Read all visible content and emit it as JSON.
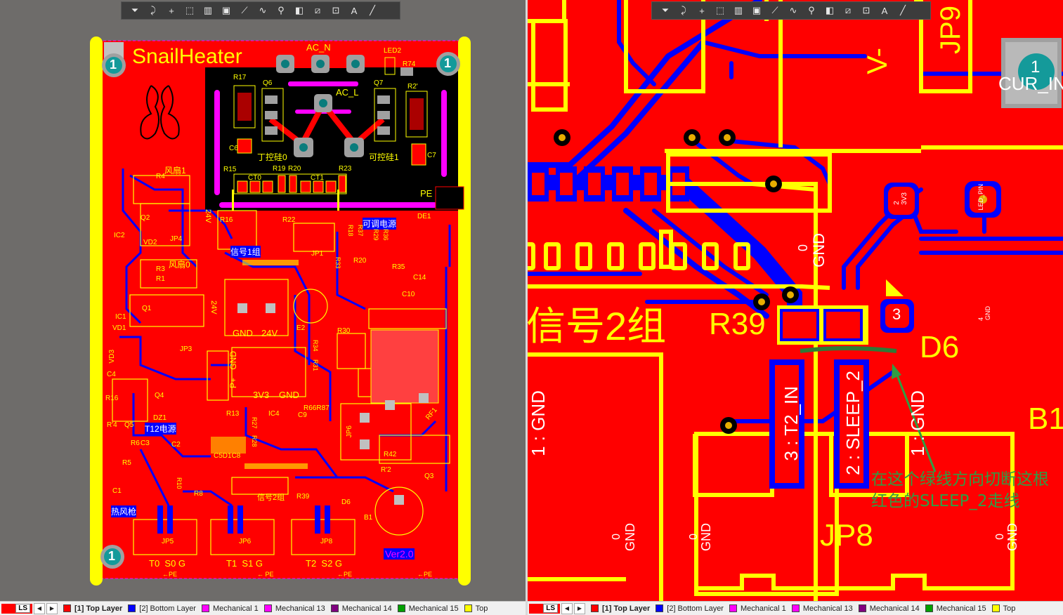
{
  "left": {
    "board": {
      "title": "SnailHeater",
      "version": "Ver2.0",
      "mount_hole_label": "1",
      "labels": {
        "ac_n": "AC_N",
        "ac_l": "AC_L",
        "led2": "LED2",
        "r74": "R74",
        "r17": "R17",
        "q6": "Q6",
        "q7": "Q7",
        "r27": "R2'",
        "c6": "C6",
        "c7": "C7",
        "iron_ctrl0": "丁控硅0",
        "iron_ctrl1": "可控硅1",
        "r15": "R15",
        "r19": "R19",
        "r20": "R20",
        "r23": "R23",
        "ct0": "CT0",
        "ct1": "CT1",
        "pe": "PE",
        "de1": "DE1",
        "fan1": "风扇1",
        "fan0": "风扇0",
        "r4": "R4",
        "r3": "R3",
        "r1": "R1",
        "q2": "Q2",
        "q1": "Q1",
        "ic2": "IC2",
        "ic1": "IC1",
        "vd1": "VD1",
        "vd2": "VD2",
        "vd3": "VD3",
        "jp4": "JP4",
        "jp3": "JP3",
        "v24": "24V",
        "v24b": "24V",
        "r16": "R16",
        "r22": "R22",
        "signal_group1": "信号1组",
        "adj_power": "可调电源",
        "jp1": "JP1",
        "r18": "R18",
        "r37": "R37",
        "r29": "R29",
        "r36": "R36",
        "r33": "R33",
        "r20b": "R20",
        "r35": "R35",
        "c14": "C14",
        "c10": "C10",
        "gnd": "GND",
        "v24c": "24V",
        "e2": "E2",
        "r30": "R30",
        "r34": "R34",
        "r31": "R31",
        "p_plus": "P+",
        "gnd_b": "GND",
        "v3v3": "3V3",
        "gnd_c": "GND",
        "c4": "C4",
        "r16b": "R16",
        "q4": "Q4",
        "dz1": "DZ1",
        "r14": "R'4",
        "q5": "Q5",
        "t12_power": "T12电源",
        "r13": "R13",
        "r27b": "R27",
        "r28": "R28",
        "ic4": "IC4",
        "c9": "C9",
        "r66r87": "R66R87",
        "rf1": "RF1",
        "r6": "R6",
        "c3": "C3",
        "c2": "C2",
        "r5": "R5",
        "c1": "C1",
        "r10": "R10",
        "r8": "R8",
        "c5d1c8": "C5D1C8",
        "heat_gun": "热风枪",
        "signal_group2_small": "信号2组",
        "r39": "R39",
        "d6": "D6",
        "r12": "R'2",
        "q3": "Q3",
        "b1": "B1",
        "jp5": "JP5",
        "jp6": "JP6",
        "jp8": "JP8",
        "r42": "R42",
        "t0": "T0  S0 G",
        "t1": "T1  S1 G",
        "t2": "T2  S2 G",
        "pe_arrow1": "←PE",
        "pe_arrow2": "← PE",
        "pe_arrow3": "←PE",
        "pe_arrow4": "←PE"
      }
    }
  },
  "right": {
    "labels": {
      "jp9": "JP9",
      "vminus": "V-",
      "cur_in_pin": "1",
      "cur_in": "CUR_IN",
      "pin_3v3": "2\n3V3",
      "led_pin": "LED_PIN",
      "gnd0": "0",
      "gnd": "GND",
      "signal_group2": "信号2组",
      "r39": "R39",
      "d6": "D6",
      "d6_pin3": "3",
      "d6_pin4": "4",
      "d6_pin4_gnd": "GND",
      "gnd1_left": "1 : GND",
      "t2_in": "3 : T2_IN",
      "sleep_2": "2 : SLEEP_2",
      "gnd1_right": "1 : GND",
      "b1": "B1",
      "jp8": "JP8",
      "bottom_gnd_0a": "0",
      "bottom_gnd_a": "GND",
      "bottom_gnd_0b": "0",
      "bottom_gnd_b": "GND",
      "bottom_gnd_0c": "0",
      "bottom_gnd_c": "GND"
    },
    "annotation": {
      "line1": "在这个绿线方向切断这根",
      "line2": "红色的SLEEP_2走线"
    }
  },
  "toolbar": {
    "icons": [
      "filter-icon",
      "route-icon",
      "plus-icon",
      "rect-select-icon",
      "bar-chart-icon",
      "component-icon",
      "track-icon",
      "arc-icon",
      "pad-icon",
      "fill-icon",
      "region-icon",
      "dimension-icon",
      "text-icon",
      "line-icon"
    ]
  },
  "statusbar": {
    "ls": "LS",
    "layers": [
      {
        "name": "[1] Top Layer",
        "color": "#ff0000",
        "active": true
      },
      {
        "name": "[2] Bottom Layer",
        "color": "#0000ff",
        "active": false
      },
      {
        "name": "Mechanical 1",
        "color": "#ff00ff",
        "active": false
      },
      {
        "name": "Mechanical 13",
        "color": "#ff00ff",
        "active": false
      },
      {
        "name": "Mechanical 14",
        "color": "#800080",
        "active": false
      },
      {
        "name": "Mechanical 15",
        "color": "#00a000",
        "active": false
      },
      {
        "name": "Top",
        "color": "#ffff00",
        "active": false
      }
    ]
  },
  "colors": {
    "top_copper": "#ff0000",
    "bottom_copper": "#0000ff",
    "silkscreen": "#ffff00",
    "keepout": "#ff00ff",
    "pad": "#9a9a9a",
    "annotation": "#2f9e44"
  }
}
